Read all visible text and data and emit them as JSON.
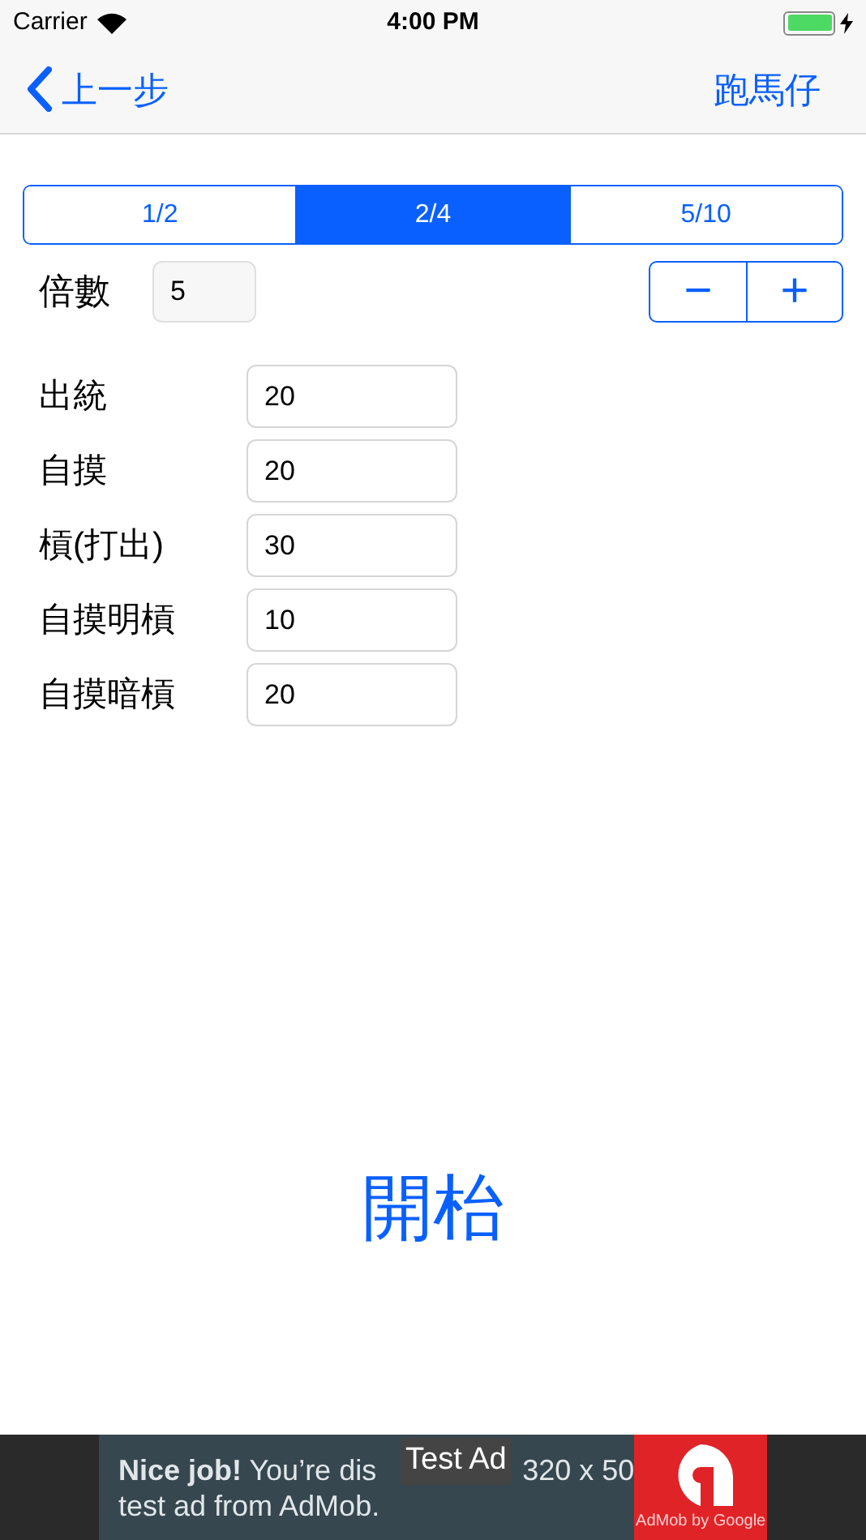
{
  "status_bar": {
    "carrier": "Carrier",
    "time": "4:00 PM",
    "charging": true
  },
  "nav": {
    "back": "上一步",
    "title": "跑馬仔"
  },
  "segments": [
    {
      "label": "1/2",
      "selected": false
    },
    {
      "label": "2/4",
      "selected": true
    },
    {
      "label": "5/10",
      "selected": false
    }
  ],
  "multiplier": {
    "label": "倍數",
    "value": "5",
    "minus": "−",
    "plus": "+"
  },
  "fields": [
    {
      "label": "出統",
      "value": "20"
    },
    {
      "label": "自摸",
      "value": "20"
    },
    {
      "label": "槓(打出)",
      "value": "30"
    },
    {
      "label": "自摸明槓",
      "value": "10"
    },
    {
      "label": "自摸暗槓",
      "value": "20"
    }
  ],
  "start_button": "開枱",
  "ad": {
    "line_1_start": "**Nice job!** You’re dis",
    "line_1_end": "320 x 50",
    "line_2": "test ad from AdMob.",
    "badge": "Test Ad",
    "brand": "AdMob by Google"
  }
}
